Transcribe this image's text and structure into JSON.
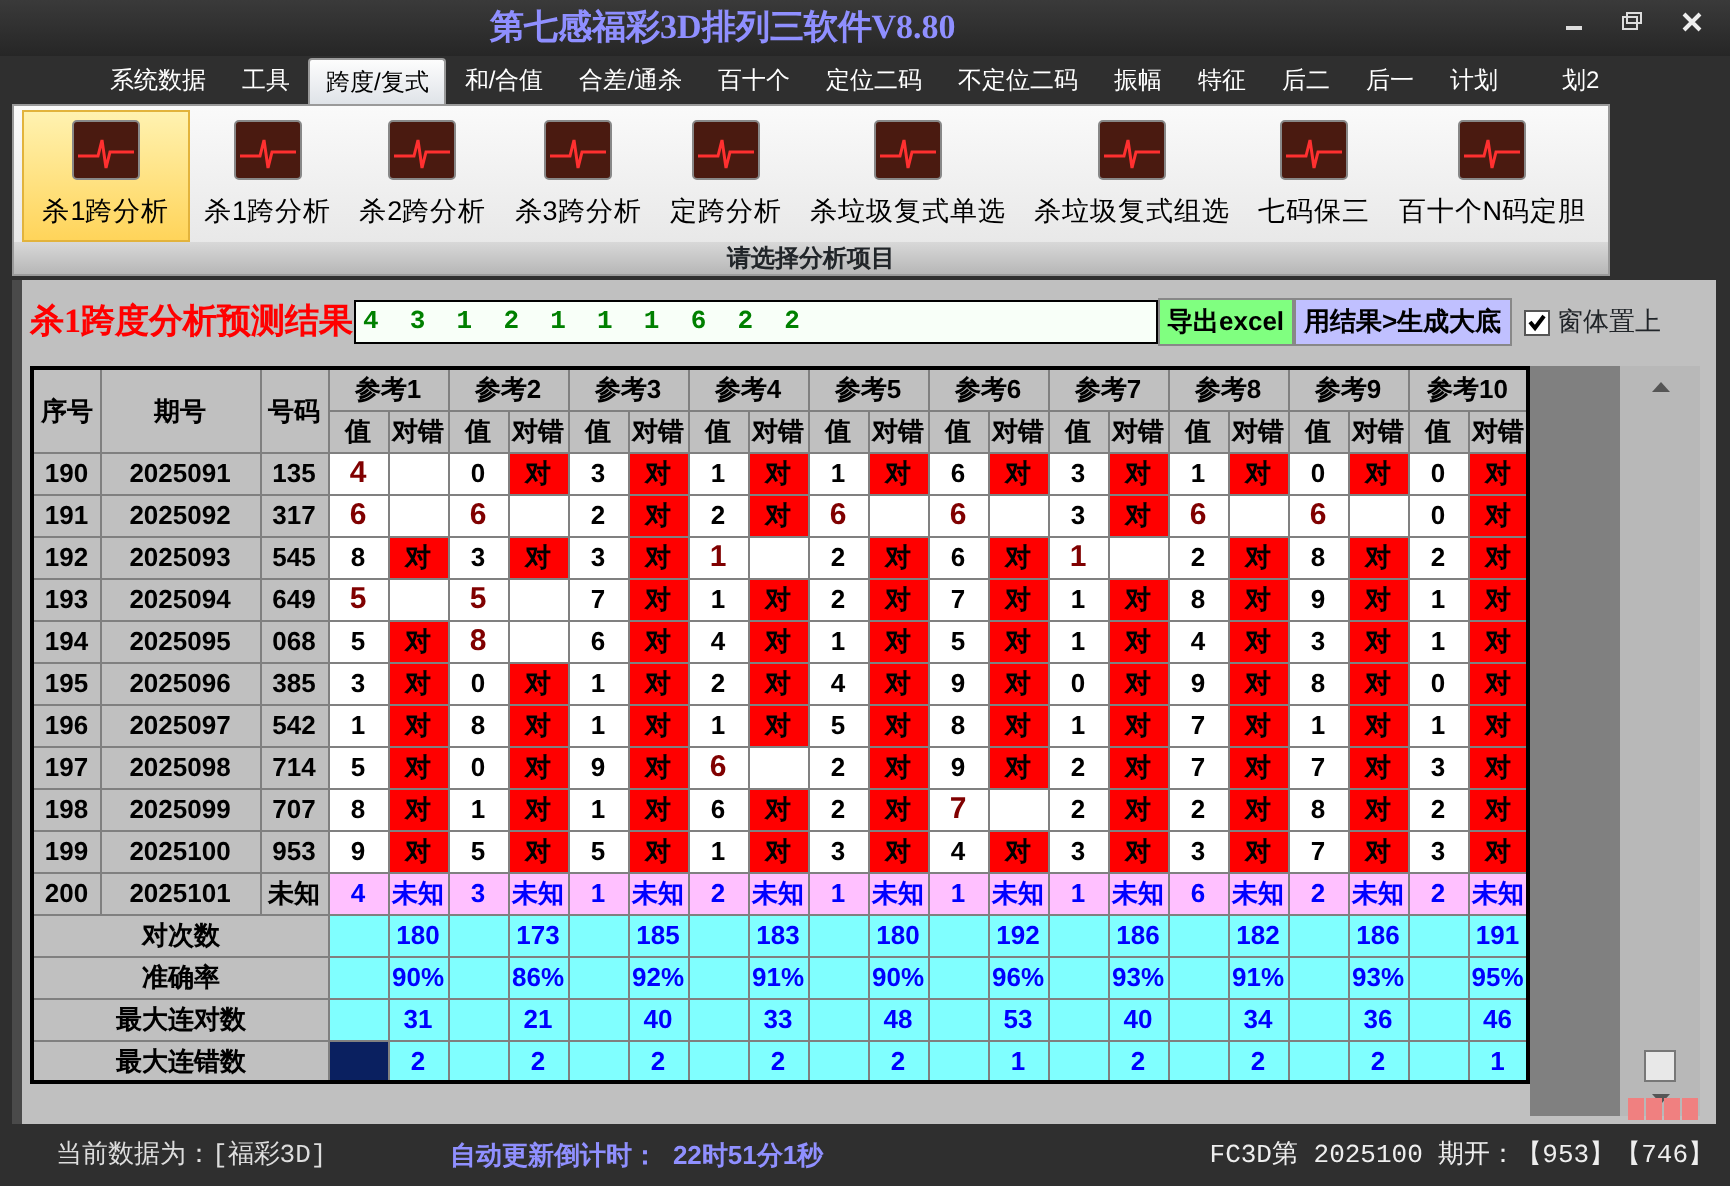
{
  "window": {
    "title": "第七感福彩3D排列三软件V8.80"
  },
  "menu": [
    {
      "label": "系统数据",
      "selected": false
    },
    {
      "label": "工具",
      "selected": false
    },
    {
      "label": "跨度/复式",
      "selected": true
    },
    {
      "label": "和/合值",
      "selected": false
    },
    {
      "label": "合差/通杀",
      "selected": false
    },
    {
      "label": "百十个",
      "selected": false
    },
    {
      "label": "定位二码",
      "selected": false
    },
    {
      "label": "不定位二码",
      "selected": false
    },
    {
      "label": "振幅",
      "selected": false
    },
    {
      "label": "特征",
      "selected": false
    },
    {
      "label": "后二",
      "selected": false
    },
    {
      "label": "后一",
      "selected": false
    },
    {
      "label": "计划",
      "selected": false
    },
    {
      "label": "划2",
      "selected": false
    }
  ],
  "ribbon": {
    "items": [
      {
        "label": "杀1跨分析",
        "selected": true
      },
      {
        "label": "杀1跨分析",
        "selected": false
      },
      {
        "label": "杀2跨分析",
        "selected": false
      },
      {
        "label": "杀3跨分析",
        "selected": false
      },
      {
        "label": "定跨分析",
        "selected": false
      },
      {
        "label": "杀垃圾复式单选",
        "selected": false
      },
      {
        "label": "杀垃圾复式组选",
        "selected": false
      },
      {
        "label": "七码保三",
        "selected": false
      },
      {
        "label": "百十个N码定胆",
        "selected": false
      }
    ],
    "group_label": "请选择分析项目"
  },
  "panel": {
    "title": "杀1跨度分析预测结果",
    "result": "4 3 1 2 1 1 1 6 2 2",
    "export_button": "导出excel",
    "generate_button": "用结果>生成大底",
    "topmost": {
      "label": "窗体置上",
      "checked": true
    }
  },
  "table": {
    "columns": [
      "序号",
      "期号",
      "号码"
    ],
    "groups": [
      {
        "label": "参考1",
        "subcolumns": [
          "值",
          "对错"
        ]
      },
      {
        "label": "参考2",
        "subcolumns": [
          "值",
          "对错"
        ]
      },
      {
        "label": "参考3",
        "subcolumns": [
          "值",
          "对错"
        ]
      },
      {
        "label": "参考4",
        "subcolumns": [
          "值",
          "对错"
        ]
      },
      {
        "label": "参考5",
        "subcolumns": [
          "值",
          "对错"
        ]
      },
      {
        "label": "参考6",
        "subcolumns": [
          "值",
          "对错"
        ]
      },
      {
        "label": "参考7",
        "subcolumns": [
          "值",
          "对错"
        ]
      },
      {
        "label": "参考8",
        "subcolumns": [
          "值",
          "对错"
        ]
      },
      {
        "label": "参考9",
        "subcolumns": [
          "值",
          "对错"
        ]
      },
      {
        "label": "参考10",
        "subcolumns": [
          "值",
          "对错"
        ]
      }
    ],
    "rows": [
      {
        "seq": "190",
        "issue": "2025091",
        "number": "135",
        "cells": [
          {
            "value": "4",
            "hit": false
          },
          {
            "value": "0",
            "hit": true,
            "verdict": "对"
          },
          {
            "value": "3",
            "hit": true,
            "verdict": "对"
          },
          {
            "value": "1",
            "hit": true,
            "verdict": "对"
          },
          {
            "value": "1",
            "hit": true,
            "verdict": "对"
          },
          {
            "value": "6",
            "hit": true,
            "verdict": "对"
          },
          {
            "value": "3",
            "hit": true,
            "verdict": "对"
          },
          {
            "value": "1",
            "hit": true,
            "verdict": "对"
          },
          {
            "value": "0",
            "hit": true,
            "verdict": "对"
          },
          {
            "value": "0",
            "hit": true,
            "verdict": "对"
          }
        ]
      },
      {
        "seq": "191",
        "issue": "2025092",
        "number": "317",
        "cells": [
          {
            "value": "6",
            "hit": false
          },
          {
            "value": "6",
            "hit": false
          },
          {
            "value": "2",
            "hit": true,
            "verdict": "对"
          },
          {
            "value": "2",
            "hit": true,
            "verdict": "对"
          },
          {
            "value": "6",
            "hit": false
          },
          {
            "value": "6",
            "hit": false
          },
          {
            "value": "3",
            "hit": true,
            "verdict": "对"
          },
          {
            "value": "6",
            "hit": false
          },
          {
            "value": "6",
            "hit": false
          },
          {
            "value": "0",
            "hit": true,
            "verdict": "对"
          }
        ]
      },
      {
        "seq": "192",
        "issue": "2025093",
        "number": "545",
        "cells": [
          {
            "value": "8",
            "hit": true,
            "verdict": "对"
          },
          {
            "value": "3",
            "hit": true,
            "verdict": "对"
          },
          {
            "value": "3",
            "hit": true,
            "verdict": "对"
          },
          {
            "value": "1",
            "hit": false
          },
          {
            "value": "2",
            "hit": true,
            "verdict": "对"
          },
          {
            "value": "6",
            "hit": true,
            "verdict": "对"
          },
          {
            "value": "1",
            "hit": false
          },
          {
            "value": "2",
            "hit": true,
            "verdict": "对"
          },
          {
            "value": "8",
            "hit": true,
            "verdict": "对"
          },
          {
            "value": "2",
            "hit": true,
            "verdict": "对"
          }
        ]
      },
      {
        "seq": "193",
        "issue": "2025094",
        "number": "649",
        "cells": [
          {
            "value": "5",
            "hit": false
          },
          {
            "value": "5",
            "hit": false
          },
          {
            "value": "7",
            "hit": true,
            "verdict": "对"
          },
          {
            "value": "1",
            "hit": true,
            "verdict": "对"
          },
          {
            "value": "2",
            "hit": true,
            "verdict": "对"
          },
          {
            "value": "7",
            "hit": true,
            "verdict": "对"
          },
          {
            "value": "1",
            "hit": true,
            "verdict": "对"
          },
          {
            "value": "8",
            "hit": true,
            "verdict": "对"
          },
          {
            "value": "9",
            "hit": true,
            "verdict": "对"
          },
          {
            "value": "1",
            "hit": true,
            "verdict": "对"
          }
        ]
      },
      {
        "seq": "194",
        "issue": "2025095",
        "number": "068",
        "cells": [
          {
            "value": "5",
            "hit": true,
            "verdict": "对"
          },
          {
            "value": "8",
            "hit": false
          },
          {
            "value": "6",
            "hit": true,
            "verdict": "对"
          },
          {
            "value": "4",
            "hit": true,
            "verdict": "对"
          },
          {
            "value": "1",
            "hit": true,
            "verdict": "对"
          },
          {
            "value": "5",
            "hit": true,
            "verdict": "对"
          },
          {
            "value": "1",
            "hit": true,
            "verdict": "对"
          },
          {
            "value": "4",
            "hit": true,
            "verdict": "对"
          },
          {
            "value": "3",
            "hit": true,
            "verdict": "对"
          },
          {
            "value": "1",
            "hit": true,
            "verdict": "对"
          }
        ]
      },
      {
        "seq": "195",
        "issue": "2025096",
        "number": "385",
        "cells": [
          {
            "value": "3",
            "hit": true,
            "verdict": "对"
          },
          {
            "value": "0",
            "hit": true,
            "verdict": "对"
          },
          {
            "value": "1",
            "hit": true,
            "verdict": "对"
          },
          {
            "value": "2",
            "hit": true,
            "verdict": "对"
          },
          {
            "value": "4",
            "hit": true,
            "verdict": "对"
          },
          {
            "value": "9",
            "hit": true,
            "verdict": "对"
          },
          {
            "value": "0",
            "hit": true,
            "verdict": "对"
          },
          {
            "value": "9",
            "hit": true,
            "verdict": "对"
          },
          {
            "value": "8",
            "hit": true,
            "verdict": "对"
          },
          {
            "value": "0",
            "hit": true,
            "verdict": "对"
          }
        ]
      },
      {
        "seq": "196",
        "issue": "2025097",
        "number": "542",
        "cells": [
          {
            "value": "1",
            "hit": true,
            "verdict": "对"
          },
          {
            "value": "8",
            "hit": true,
            "verdict": "对"
          },
          {
            "value": "1",
            "hit": true,
            "verdict": "对"
          },
          {
            "value": "1",
            "hit": true,
            "verdict": "对"
          },
          {
            "value": "5",
            "hit": true,
            "verdict": "对"
          },
          {
            "value": "8",
            "hit": true,
            "verdict": "对"
          },
          {
            "value": "1",
            "hit": true,
            "verdict": "对"
          },
          {
            "value": "7",
            "hit": true,
            "verdict": "对"
          },
          {
            "value": "1",
            "hit": true,
            "verdict": "对"
          },
          {
            "value": "1",
            "hit": true,
            "verdict": "对"
          }
        ]
      },
      {
        "seq": "197",
        "issue": "2025098",
        "number": "714",
        "cells": [
          {
            "value": "5",
            "hit": true,
            "verdict": "对"
          },
          {
            "value": "0",
            "hit": true,
            "verdict": "对"
          },
          {
            "value": "9",
            "hit": true,
            "verdict": "对"
          },
          {
            "value": "6",
            "hit": false
          },
          {
            "value": "2",
            "hit": true,
            "verdict": "对"
          },
          {
            "value": "9",
            "hit": true,
            "verdict": "对"
          },
          {
            "value": "2",
            "hit": true,
            "verdict": "对"
          },
          {
            "value": "7",
            "hit": true,
            "verdict": "对"
          },
          {
            "value": "7",
            "hit": true,
            "verdict": "对"
          },
          {
            "value": "3",
            "hit": true,
            "verdict": "对"
          }
        ]
      },
      {
        "seq": "198",
        "issue": "2025099",
        "number": "707",
        "cells": [
          {
            "value": "8",
            "hit": true,
            "verdict": "对"
          },
          {
            "value": "1",
            "hit": true,
            "verdict": "对"
          },
          {
            "value": "1",
            "hit": true,
            "verdict": "对"
          },
          {
            "value": "6",
            "hit": true,
            "verdict": "对"
          },
          {
            "value": "2",
            "hit": true,
            "verdict": "对"
          },
          {
            "value": "7",
            "hit": false
          },
          {
            "value": "2",
            "hit": true,
            "verdict": "对"
          },
          {
            "value": "2",
            "hit": true,
            "verdict": "对"
          },
          {
            "value": "8",
            "hit": true,
            "verdict": "对"
          },
          {
            "value": "2",
            "hit": true,
            "verdict": "对"
          }
        ]
      },
      {
        "seq": "199",
        "issue": "2025100",
        "number": "953",
        "cells": [
          {
            "value": "9",
            "hit": true,
            "verdict": "对"
          },
          {
            "value": "5",
            "hit": true,
            "verdict": "对"
          },
          {
            "value": "5",
            "hit": true,
            "verdict": "对"
          },
          {
            "value": "1",
            "hit": true,
            "verdict": "对"
          },
          {
            "value": "3",
            "hit": true,
            "verdict": "对"
          },
          {
            "value": "4",
            "hit": true,
            "verdict": "对"
          },
          {
            "value": "3",
            "hit": true,
            "verdict": "对"
          },
          {
            "value": "3",
            "hit": true,
            "verdict": "对"
          },
          {
            "value": "7",
            "hit": true,
            "verdict": "对"
          },
          {
            "value": "3",
            "hit": true,
            "verdict": "对"
          }
        ]
      }
    ],
    "pending_row": {
      "seq": "200",
      "issue": "2025101",
      "number": "未知",
      "cells": [
        {
          "value": "4",
          "verdict": "未知"
        },
        {
          "value": "3",
          "verdict": "未知"
        },
        {
          "value": "1",
          "verdict": "未知"
        },
        {
          "value": "2",
          "verdict": "未知"
        },
        {
          "value": "1",
          "verdict": "未知"
        },
        {
          "value": "1",
          "verdict": "未知"
        },
        {
          "value": "1",
          "verdict": "未知"
        },
        {
          "value": "6",
          "verdict": "未知"
        },
        {
          "value": "2",
          "verdict": "未知"
        },
        {
          "value": "2",
          "verdict": "未知"
        }
      ]
    },
    "stats": [
      {
        "label": "对次数",
        "values": [
          "180",
          "173",
          "185",
          "183",
          "180",
          "192",
          "186",
          "182",
          "186",
          "191"
        ]
      },
      {
        "label": "准确率",
        "values": [
          "90%",
          "86%",
          "92%",
          "91%",
          "90%",
          "96%",
          "93%",
          "91%",
          "93%",
          "95%"
        ]
      },
      {
        "label": "最大连对数",
        "values": [
          "31",
          "21",
          "40",
          "33",
          "48",
          "53",
          "40",
          "34",
          "36",
          "46"
        ]
      },
      {
        "label": "最大连错数",
        "values": [
          "2",
          "2",
          "2",
          "2",
          "2",
          "1",
          "2",
          "2",
          "2",
          "1"
        ]
      }
    ]
  },
  "status_bar": {
    "data_source": "当前数据为：[福彩3D]",
    "countdown": "自动更新倒计时：  22时51分1秒",
    "draw": "FC3D第 2025100 期开：【953】【746】"
  }
}
